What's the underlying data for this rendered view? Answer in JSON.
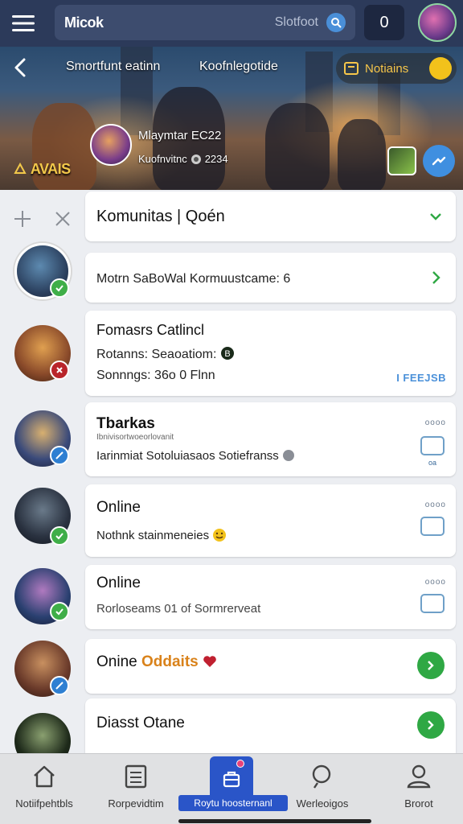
{
  "topbar": {
    "app_title": "Micok",
    "search_hint": "Slotfoot",
    "count": "0"
  },
  "banner": {
    "tab1": "Smortfunt eatinn",
    "tab2": "Koofnlegotide",
    "notif_label": "Notiains",
    "streamer_name": "Mlaymtar EC22",
    "streamer_meta_left": "Kuofnvitnc",
    "streamer_meta_right": "2234",
    "brand_logo": "AVAIS"
  },
  "list": {
    "header_card": {
      "title": "Komunitas | Qoén"
    },
    "row1": {
      "text": "Motrn SaBoWal Kormuustcame: 6"
    },
    "row2": {
      "title": "Fomasrs Catlincl",
      "line1": "Rotanns: Seaoatiom:",
      "line2": "Sonnngs: 36o 0 Flnn",
      "badge": "I FEEJSB"
    },
    "row3": {
      "title": "Tbarkas",
      "sub": "Ibnivisortwoeorlovanit",
      "line1": "Iarinmiat Sotoluiasaos Sotiefranss",
      "meta": "oooo",
      "chk_tail": "oa"
    },
    "row4": {
      "title": "Online",
      "line1": "Nothnk stainmeneies",
      "meta": "oooo"
    },
    "row5": {
      "title": "Online",
      "line1": "Rorloseams 01 of Sormrerveat",
      "meta": "oooo"
    },
    "row6": {
      "title_a": "Onine",
      "title_b": "Oddaits"
    },
    "row7": {
      "title": "Diasst Otane"
    }
  },
  "bottom_nav": {
    "items": [
      {
        "label": "Notiifpehtbls"
      },
      {
        "label": "Rorpevidtim"
      },
      {
        "label": "Roytu hoosternanl"
      },
      {
        "label": "Werleoigos"
      },
      {
        "label": "Brorot"
      }
    ]
  },
  "colors": {
    "topbar": "#2c3a5a",
    "accent_blue": "#2a55c8",
    "online_green": "#3fae48",
    "gold": "#f2c21b",
    "orange_text": "#d9821a"
  }
}
